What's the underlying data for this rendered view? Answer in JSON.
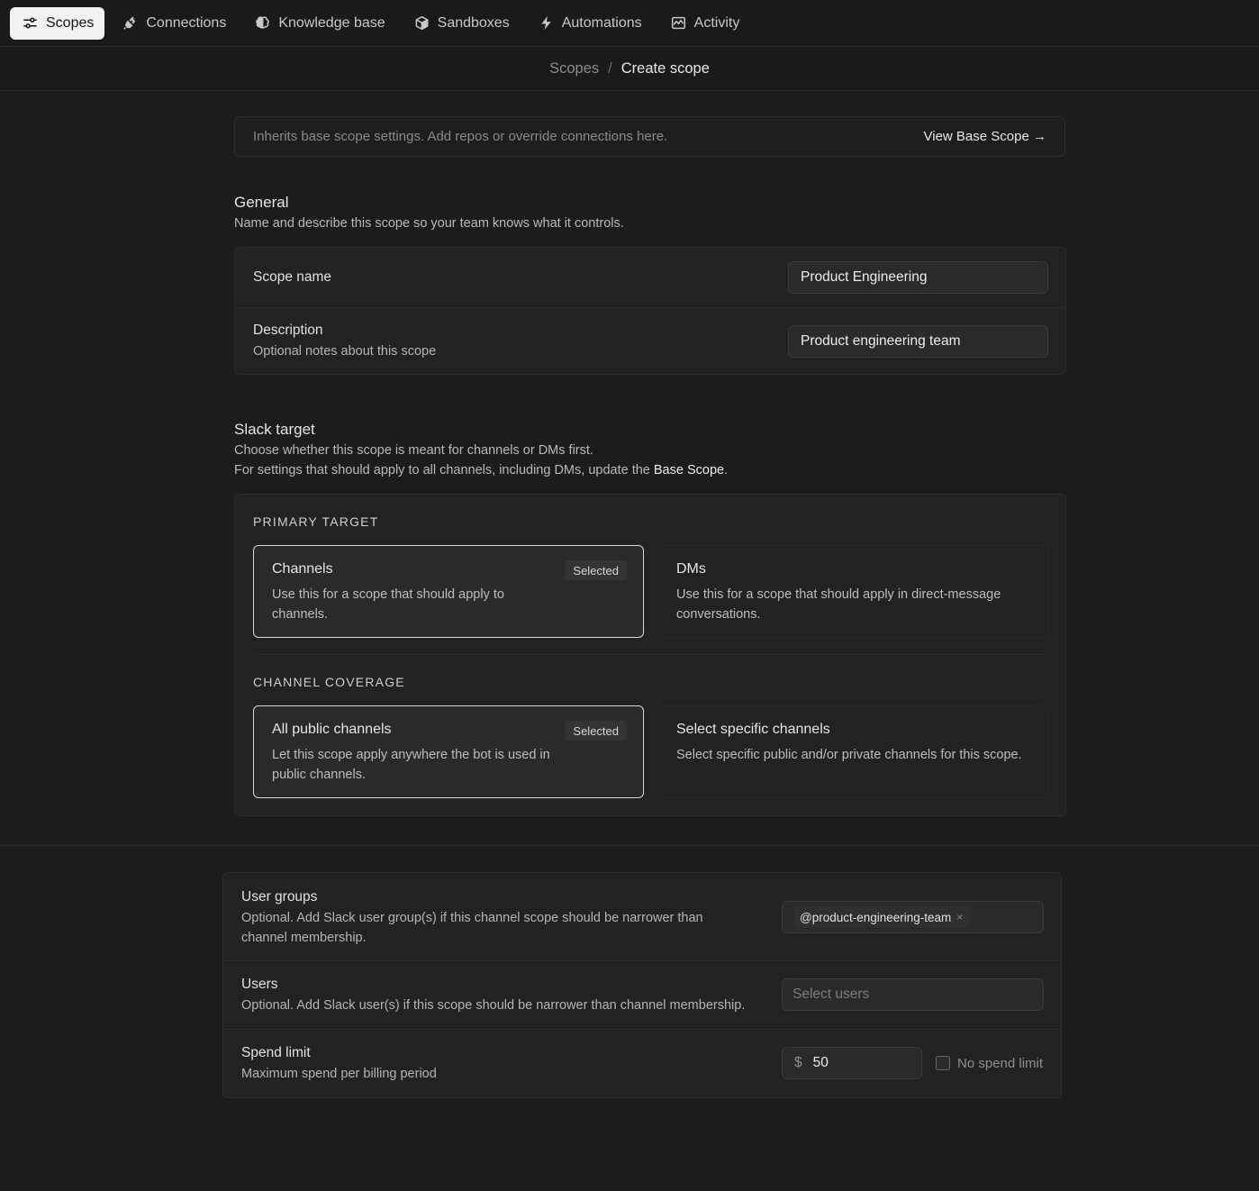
{
  "nav": {
    "tabs": [
      {
        "label": "Scopes",
        "icon": "sliders-icon",
        "active": true
      },
      {
        "label": "Connections",
        "icon": "plug-icon"
      },
      {
        "label": "Knowledge base",
        "icon": "brain-icon"
      },
      {
        "label": "Sandboxes",
        "icon": "cube-icon"
      },
      {
        "label": "Automations",
        "icon": "lightning-icon"
      },
      {
        "label": "Activity",
        "icon": "activity-chart-icon"
      }
    ]
  },
  "breadcrumb": {
    "parent": "Scopes",
    "separator": "/",
    "current": "Create scope"
  },
  "banner": {
    "text": "Inherits base scope settings. Add repos or override connections here.",
    "link": "View Base Scope",
    "link_arrow": "→"
  },
  "general": {
    "title": "General",
    "description": "Name and describe this scope so your team knows what it controls.",
    "scope_name_label": "Scope name",
    "scope_name_value": "Product Engineering",
    "description_label": "Description",
    "description_sub": "Optional notes about this scope",
    "description_value": "Product engineering team"
  },
  "slack": {
    "title": "Slack target",
    "desc_line1": "Choose whether this scope is meant for channels or DMs first.",
    "desc_line2_prefix": "For settings that should apply to all channels, including DMs, update the ",
    "desc_line2_bold": "Base Scope",
    "desc_line2_suffix": ".",
    "primary_target_heading": "PRIMARY TARGET",
    "channels": {
      "title": "Channels",
      "desc": "Use this for a scope that should apply to channels.",
      "badge": "Selected"
    },
    "dms": {
      "title": "DMs",
      "desc": "Use this for a scope that should apply in direct-message conversations."
    },
    "channel_coverage_heading": "CHANNEL COVERAGE",
    "all_public": {
      "title": "All public channels",
      "desc": "Let this scope apply anywhere the bot is used in public channels.",
      "badge": "Selected"
    },
    "specific": {
      "title": "Select specific channels",
      "desc": "Select specific public and/or private channels for this scope."
    }
  },
  "restrictions": {
    "user_groups_label": "User groups",
    "user_groups_sub": "Optional. Add Slack user group(s) if this channel scope should be narrower than channel membership.",
    "user_group_chip": "@product-engineering-team",
    "chip_remove": "×",
    "users_label": "Users",
    "users_sub": "Optional. Add Slack user(s) if this scope should be narrower than channel membership.",
    "users_placeholder": "Select users",
    "spend_label": "Spend limit",
    "spend_sub": "Maximum spend per billing period",
    "currency": "$",
    "spend_value": "50",
    "no_limit_label": "No spend limit",
    "no_limit_checked": false
  }
}
